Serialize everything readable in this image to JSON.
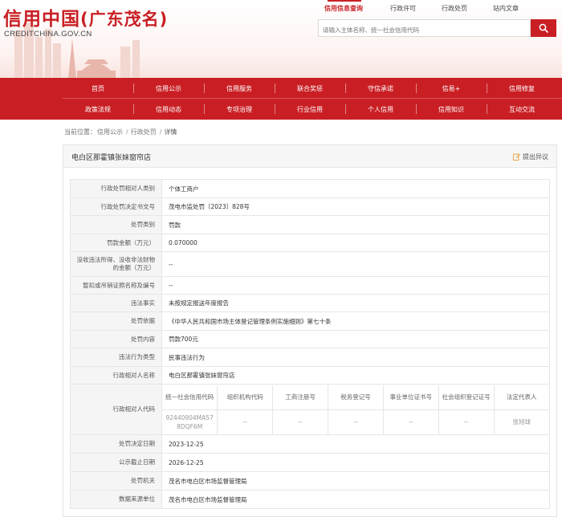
{
  "header": {
    "title_main": "信用中国",
    "title_sub": "(广东茂名)",
    "domain": "CREDITCHINA.GOV.CN",
    "top_nav": [
      "信用信息查询",
      "行政许可",
      "行政处罚",
      "站内文章"
    ],
    "search_placeholder": "请输入主体名称、统一社会信用代码"
  },
  "main_nav": {
    "row1": [
      "首页",
      "信用公示",
      "信用服务",
      "联合奖惩",
      "守信承诺",
      "信易+",
      "信用修复"
    ],
    "row2": [
      "政策法规",
      "信用动态",
      "专项治理",
      "行业信用",
      "个人信用",
      "信用知识",
      "互动交流"
    ]
  },
  "breadcrumb": {
    "label": "当前位置：",
    "items": [
      "信用公示",
      "行政处罚",
      "详情"
    ]
  },
  "card": {
    "title": "电白区那霍镇张妹窗帘店",
    "objection": "提出异议"
  },
  "details": {
    "rows_top": [
      {
        "label": "行政处罚相对人类别",
        "value": "个体工商户"
      },
      {
        "label": "行政处罚决定书文号",
        "value": "茂电市监处罚〔2023〕828号"
      },
      {
        "label": "处罚类别",
        "value": "罚款"
      },
      {
        "label": "罚款金额（万元）",
        "value": "0.070000"
      },
      {
        "label": "没收违法所得、没收非法财物的金额（万元）",
        "value": "--"
      },
      {
        "label": "暂扣或吊销证照名称及编号",
        "value": "--"
      },
      {
        "label": "违法事实",
        "value": "未按规定报送年度报告"
      },
      {
        "label": "处罚依据",
        "value": "《中华人民共和国市场主体登记管理条例实施细则》第七十条"
      },
      {
        "label": "处罚内容",
        "value": "罚款700元"
      },
      {
        "label": "违法行为类型",
        "value": "民事违法行为"
      },
      {
        "label": "行政相对人名称",
        "value": "电白区那霍镇张妹窗帘店"
      }
    ],
    "code_label": "行政相对人代码",
    "code_headers": [
      "统一社会信用代码",
      "组织机构代码",
      "工商注册号",
      "税务登记号",
      "事业单位证书号",
      "社会组织登记证号",
      "法定代表人"
    ],
    "code_values": [
      "92440904MA578DQF6M",
      "--",
      "--",
      "--",
      "--",
      "--",
      "张旭球"
    ],
    "rows_bottom": [
      {
        "label": "处罚决定日期",
        "value": "2023-12-25"
      },
      {
        "label": "公示截止日期",
        "value": "2026-12-25"
      },
      {
        "label": "处罚机关",
        "value": "茂名市电白区市场监督管理局"
      },
      {
        "label": "数据来源单位",
        "value": "茂名市电白区市场监督管理局"
      }
    ]
  },
  "colors": {
    "brand_red": "#c91f24"
  }
}
